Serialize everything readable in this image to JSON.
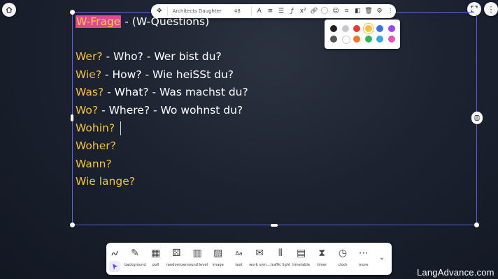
{
  "format_toolbar": {
    "font_name": "Architects Daughter",
    "font_size": "48"
  },
  "palette": {
    "row1": [
      "#1e1e1e",
      "#c8c8c8",
      "#e23b3b",
      "#f3c042",
      "#3a6fe0",
      "#9a47e6"
    ],
    "row2": [
      "#555555",
      "#ffffff",
      "#f07a2a",
      "#2fb55a",
      "#3aa7e0",
      "#e356b8"
    ],
    "selected": "#f3c042"
  },
  "content": {
    "heading_highlight": "W-Frage",
    "heading_rest": " - (W-Questions)",
    "rows": [
      {
        "word": "Wer?",
        "rest": " - Who? - Wer bist du?"
      },
      {
        "word": "Wie?",
        "rest": " - How? - Wie heiSSt du?"
      },
      {
        "word": "Was?",
        "rest": " - What? - Was machst du?"
      },
      {
        "word": "Wo?",
        "rest": " - Where? - Wo wohnst du?"
      },
      {
        "word": "Wohin?",
        "rest": ""
      },
      {
        "word": "Woher?",
        "rest": ""
      },
      {
        "word": "Wann?",
        "rest": ""
      },
      {
        "word": "Wie lange?",
        "rest": ""
      }
    ]
  },
  "bottom_toolbar": {
    "tools": [
      "background",
      "poll",
      "randomizer",
      "sound level",
      "image",
      "text",
      "work sym...",
      "traffic light",
      "timetable",
      "timer",
      "clock",
      "more"
    ]
  },
  "brand": "LangAdvance.com",
  "colors": {
    "accent": "#5a63d8",
    "highlight_bg": "#e1498d",
    "yellow_text": "#f3c042"
  }
}
